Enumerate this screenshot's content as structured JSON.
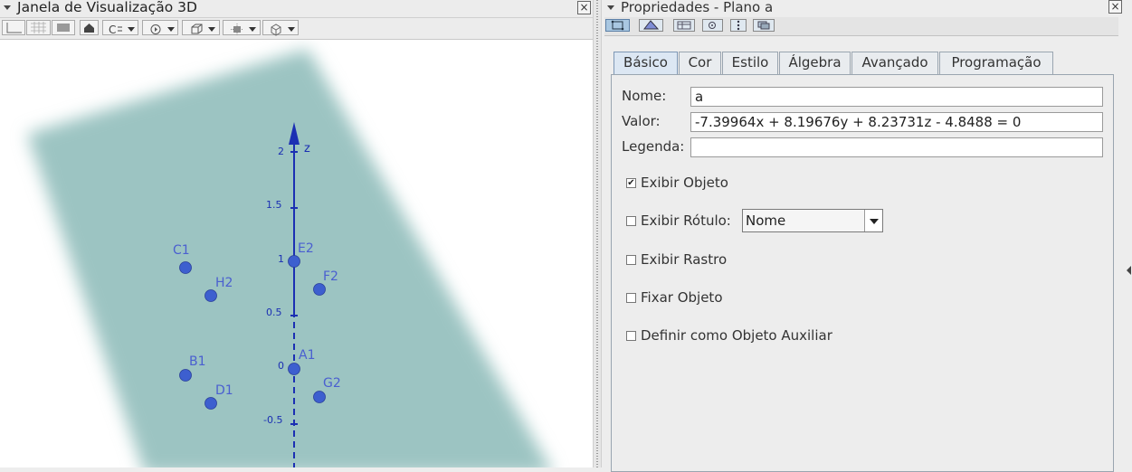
{
  "view3d": {
    "title": "Janela de Visualização 3D",
    "close": "×",
    "axis_label": "z",
    "ticks": [
      "2",
      "1.5",
      "1",
      "0.5",
      "0",
      "-0.5"
    ],
    "points": [
      "C1",
      "H2",
      "E2",
      "F2",
      "B1",
      "A1",
      "D1",
      "G2"
    ],
    "plane_color": "#9cc4c2",
    "point_color": "#3d5fcf",
    "axis_color": "#1b2fb3"
  },
  "properties": {
    "title": "Propriedades - Plano a",
    "close": "×",
    "tabs": [
      "Básico",
      "Cor",
      "Estilo",
      "Álgebra",
      "Avançado",
      "Programação"
    ],
    "active_tab": "Básico",
    "name_label": "Nome:",
    "name_value": "a",
    "value_label": "Valor:",
    "value_value": "-7.39964x + 8.19676y + 8.23731z - 4.8488 = 0",
    "caption_label": "Legenda:",
    "caption_value": "",
    "show_object": {
      "label": "Exibir Objeto",
      "checked": true,
      "mark": "✔"
    },
    "show_label": {
      "label": "Exibir Rótulo:",
      "checked": false,
      "option": "Nome"
    },
    "show_trace": {
      "label": "Exibir Rastro",
      "checked": false
    },
    "fix_object": {
      "label": "Fixar Objeto",
      "checked": false
    },
    "auxiliary": {
      "label": "Definir como Objeto Auxiliar",
      "checked": false
    }
  }
}
